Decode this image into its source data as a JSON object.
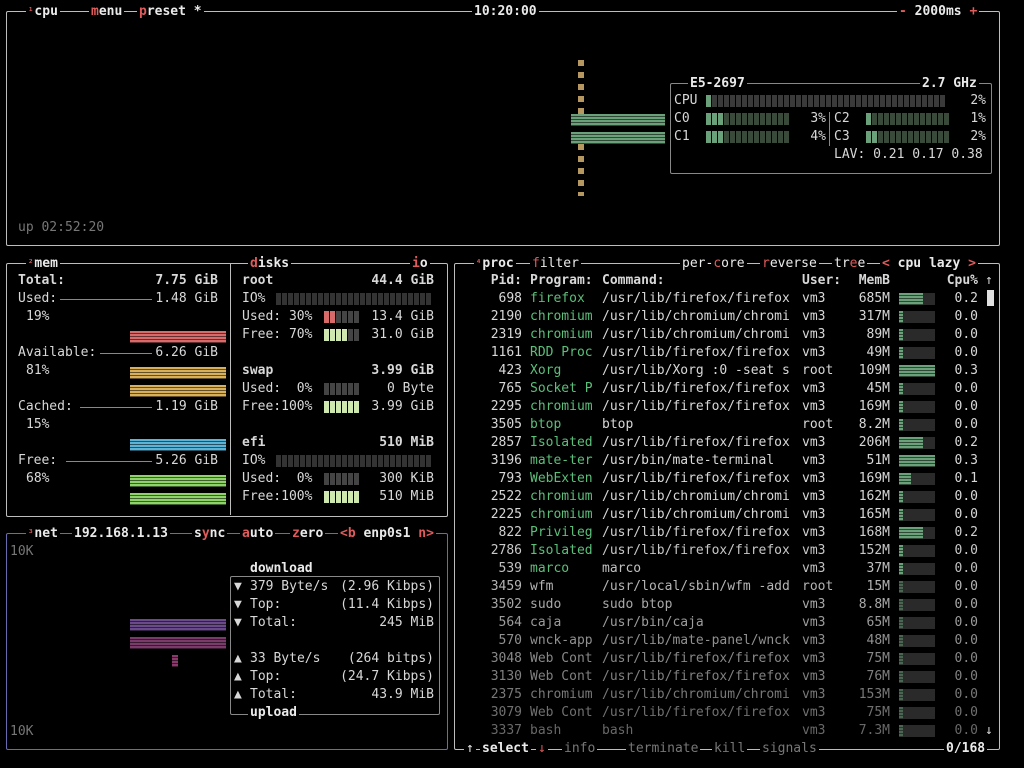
{
  "cpu_box": {
    "tab_num": "¹",
    "tab_label": "cpu",
    "menu_label": "menu",
    "preset_label": "preset *",
    "clock": "10:20:00",
    "interval": "2000ms",
    "minus": "-",
    "plus": "+",
    "uptime": "up 02:52:20",
    "cpu_name": "E5-2697",
    "cpu_freq": "2.7 GHz",
    "total_label": "CPU",
    "total_pct": "2%",
    "cores": [
      {
        "name": "C0",
        "pct": "3%"
      },
      {
        "name": "C1",
        "pct": "4%"
      },
      {
        "name": "C2",
        "pct": "1%"
      },
      {
        "name": "C3",
        "pct": "2%"
      }
    ],
    "lav": "LAV: 0.21 0.17 0.38"
  },
  "mem_box": {
    "tab_num": "²",
    "tab_label": "mem",
    "total_label": "Total:",
    "total_val": "7.75 GiB",
    "used_label": "Used:",
    "used_val": "1.48 GiB",
    "used_pct": "19%",
    "avail_label": "Available:",
    "avail_val": "6.26 GiB",
    "avail_pct": "81%",
    "cached_label": "Cached:",
    "cached_val": "1.19 GiB",
    "cached_pct": "15%",
    "free_label": "Free:",
    "free_val": "5.26 GiB",
    "free_pct": "68%"
  },
  "disks_box": {
    "tab_label": "disks",
    "io_label": "io",
    "root": {
      "name": "root",
      "size": "44.4 GiB",
      "io": "IO%",
      "used_label": "Used: 30%",
      "used_val": "13.4 GiB",
      "free_label": "Free: 70%",
      "free_val": "31.0 GiB",
      "used_frac": 0.3,
      "free_frac": 0.7
    },
    "swap": {
      "name": "swap",
      "size": "3.99 GiB",
      "used_label": "Used:  0%",
      "used_val": "0 Byte",
      "free_label": "Free:100%",
      "free_val": "3.99 GiB",
      "used_frac": 0.0,
      "free_frac": 1.0
    },
    "efi": {
      "name": "efi",
      "size": "510 MiB",
      "io": "IO%",
      "used_label": "Used:  0%",
      "used_val": "300 KiB",
      "free_label": "Free:100%",
      "free_val": "510 MiB",
      "used_frac": 0.0,
      "free_frac": 1.0
    }
  },
  "net_box": {
    "tab_num": "³",
    "tab_label": "net",
    "ip": "192.168.1.13",
    "sync": "sync",
    "auto": "auto",
    "zero": "zero",
    "prev": "<b",
    "iface": "enp0s1",
    "next": "n>",
    "scale_top": "10K",
    "scale_bottom": "10K",
    "download_title": "download",
    "upload_title": "upload",
    "down_rows": [
      {
        "arrow": "▼",
        "label": "379 Byte/s",
        "val": "(2.96 Kibps)"
      },
      {
        "arrow": "▼",
        "label": "Top:",
        "val": "(11.4 Kibps)"
      },
      {
        "arrow": "▼",
        "label": "Total:",
        "val": "245 MiB"
      }
    ],
    "up_rows": [
      {
        "arrow": "▲",
        "label": "33 Byte/s",
        "val": "(264 bitps)"
      },
      {
        "arrow": "▲",
        "label": "Top:",
        "val": "(24.7 Kibps)"
      },
      {
        "arrow": "▲",
        "label": "Total:",
        "val": "43.9 MiB"
      }
    ]
  },
  "proc_box": {
    "tab_num": "⁴",
    "tab_label": "proc",
    "filter": "filter",
    "per_core": "per-core",
    "reverse": "reverse",
    "tree": "tree",
    "sort_prev": "<",
    "sort_label": "cpu lazy",
    "sort_next": ">",
    "headers": {
      "pid": "Pid:",
      "program": "Program:",
      "command": "Command:",
      "user": "User:",
      "mem": "MemB",
      "cpu": "Cpu%"
    },
    "rows": [
      {
        "pid": "698",
        "program": "firefox",
        "command": "/usr/lib/firefox/firefox",
        "user": "vm3",
        "mem": "685M",
        "cpu": "0.2"
      },
      {
        "pid": "2190",
        "program": "chromium",
        "command": "/usr/lib/chromium/chromi",
        "user": "vm3",
        "mem": "317M",
        "cpu": "0.0"
      },
      {
        "pid": "2319",
        "program": "chromium",
        "command": "/usr/lib/chromium/chromi",
        "user": "vm3",
        "mem": "89M",
        "cpu": "0.0"
      },
      {
        "pid": "1161",
        "program": "RDD Proc",
        "command": "/usr/lib/firefox/firefox",
        "user": "vm3",
        "mem": "49M",
        "cpu": "0.0"
      },
      {
        "pid": "423",
        "program": "Xorg",
        "command": "/usr/lib/Xorg :0 -seat s",
        "user": "root",
        "mem": "109M",
        "cpu": "0.3"
      },
      {
        "pid": "765",
        "program": "Socket P",
        "command": "/usr/lib/firefox/firefox",
        "user": "vm3",
        "mem": "45M",
        "cpu": "0.0"
      },
      {
        "pid": "2295",
        "program": "chromium",
        "command": "/usr/lib/firefox/firefox",
        "user": "vm3",
        "mem": "169M",
        "cpu": "0.0"
      },
      {
        "pid": "3505",
        "program": "btop",
        "command": "btop",
        "user": "root",
        "mem": "8.2M",
        "cpu": "0.0"
      },
      {
        "pid": "2857",
        "program": "Isolated",
        "command": "/usr/lib/firefox/firefox",
        "user": "vm3",
        "mem": "206M",
        "cpu": "0.2"
      },
      {
        "pid": "3196",
        "program": "mate-ter",
        "command": "/usr/bin/mate-terminal",
        "user": "vm3",
        "mem": "51M",
        "cpu": "0.3"
      },
      {
        "pid": "793",
        "program": "WebExten",
        "command": "/usr/lib/firefox/firefox",
        "user": "vm3",
        "mem": "169M",
        "cpu": "0.1"
      },
      {
        "pid": "2522",
        "program": "chromium",
        "command": "/usr/lib/chromium/chromi",
        "user": "vm3",
        "mem": "162M",
        "cpu": "0.0"
      },
      {
        "pid": "2225",
        "program": "chromium",
        "command": "/usr/lib/chromium/chromi",
        "user": "vm3",
        "mem": "165M",
        "cpu": "0.0"
      },
      {
        "pid": "822",
        "program": "Privileg",
        "command": "/usr/lib/firefox/firefox",
        "user": "vm3",
        "mem": "168M",
        "cpu": "0.2"
      },
      {
        "pid": "2786",
        "program": "Isolated",
        "command": "/usr/lib/firefox/firefox",
        "user": "vm3",
        "mem": "152M",
        "cpu": "0.0"
      },
      {
        "pid": "539",
        "program": "marco",
        "command": "marco",
        "user": "vm3",
        "mem": "37M",
        "cpu": "0.0"
      },
      {
        "pid": "3459",
        "program": "wfm",
        "command": "/usr/local/sbin/wfm -add",
        "user": "root",
        "mem": "15M",
        "cpu": "0.0"
      },
      {
        "pid": "3502",
        "program": "sudo",
        "command": "sudo btop",
        "user": "vm3",
        "mem": "8.8M",
        "cpu": "0.0"
      },
      {
        "pid": "564",
        "program": "caja",
        "command": "/usr/bin/caja",
        "user": "vm3",
        "mem": "65M",
        "cpu": "0.0"
      },
      {
        "pid": "570",
        "program": "wnck-app",
        "command": "/usr/lib/mate-panel/wnck",
        "user": "vm3",
        "mem": "48M",
        "cpu": "0.0"
      },
      {
        "pid": "3048",
        "program": "Web Cont",
        "command": "/usr/lib/firefox/firefox",
        "user": "vm3",
        "mem": "75M",
        "cpu": "0.0"
      },
      {
        "pid": "3130",
        "program": "Web Cont",
        "command": "/usr/lib/firefox/firefox",
        "user": "vm3",
        "mem": "76M",
        "cpu": "0.0"
      },
      {
        "pid": "2375",
        "program": "chromium",
        "command": "/usr/lib/chromium/chromi",
        "user": "vm3",
        "mem": "153M",
        "cpu": "0.0"
      },
      {
        "pid": "3079",
        "program": "Web Cont",
        "command": "/usr/lib/firefox/firefox",
        "user": "vm3",
        "mem": "75M",
        "cpu": "0.0"
      },
      {
        "pid": "3337",
        "program": "bash",
        "command": "bash",
        "user": "vm3",
        "mem": "7.3M",
        "cpu": "0.0"
      }
    ],
    "footer": {
      "up": "↑",
      "select": "select",
      "down": "↓",
      "info": "info",
      "terminate": "terminate",
      "kill": "kill",
      "signals": "signals",
      "count": "0/168"
    }
  },
  "colors": {
    "accent": "#e05b5b",
    "program": "#5bbf7a",
    "border": "#bdbdbd",
    "net_border": "#6a6ab0",
    "mem_used": "#d86a6a",
    "mem_avail": "#d8b05a",
    "mem_cached": "#5ab4d8",
    "mem_free": "#8ed26a"
  }
}
